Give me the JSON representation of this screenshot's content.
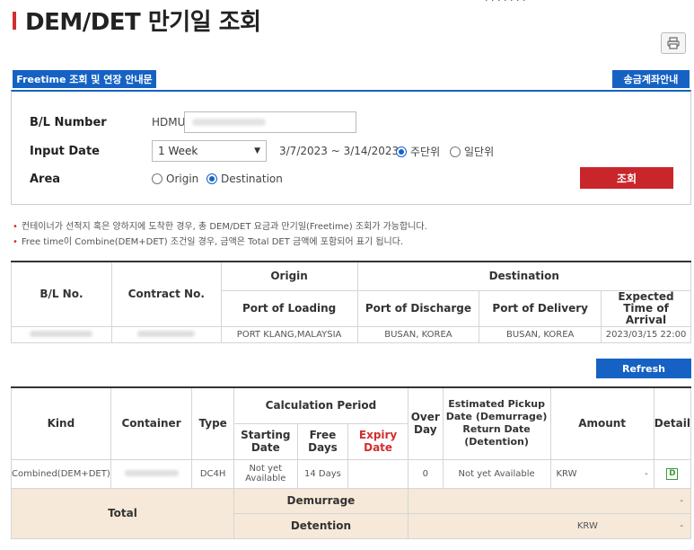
{
  "header": {
    "title": "DEM/DET 만기일 조회",
    "top_cut_text": "· · ·  · · · ·"
  },
  "buttons": {
    "freetime": "Freetime 조회 및 연장 안내문",
    "bank": "송금계좌안내",
    "search": "조회",
    "refresh": "Refresh",
    "print_icon": "printer-icon"
  },
  "search": {
    "bl_label": "B/L Number",
    "bl_prefix": "HDMU",
    "date_label": "Input Date",
    "date_select": "1 Week",
    "date_range": "3/7/2023 ~ 3/14/2023",
    "weekly": "주단위",
    "daily": "일단위",
    "area_label": "Area",
    "origin": "Origin",
    "destination": "Destination"
  },
  "notes": [
    "컨테이너가 선적지 혹은 양하지에 도착한 경우, 총 DEM/DET 요금과 만기일(Freetime) 조회가 가능합니다.",
    "Free time이 Combine(DEM+DET) 조건일 경우, 금액은 Total DET 금액에 포함되어 표기 됩니다."
  ],
  "bl_table": {
    "h_bl": "B/L No.",
    "h_contract": "Contract No.",
    "h_origin": "Origin",
    "h_destination": "Destination",
    "h_pol": "Port of Loading",
    "h_pod": "Port of Discharge",
    "h_del": "Port of Delivery",
    "h_eta": "Expected Time of Arrival",
    "row": {
      "pol": "PORT KLANG,MALAYSIA",
      "pod": "BUSAN, KOREA",
      "del": "BUSAN, KOREA",
      "eta": "2023/03/15 22:00"
    }
  },
  "calc_table": {
    "h_kind": "Kind",
    "h_container": "Container",
    "h_type": "Type",
    "h_calc": "Calculation Period",
    "h_start": "Starting Date",
    "h_free": "Free Days",
    "h_expiry": "Expiry Date",
    "h_over": "Over Day",
    "h_pickup": "Estimated Pickup Date (Demurrage) Return Date (Detention)",
    "h_amount": "Amount",
    "h_detail": "Detail",
    "row": {
      "kind": "Combined(DEM+DET)",
      "type": "DC4H",
      "start": "Not yet Available",
      "free": "14 Days",
      "expiry": "",
      "over": "0",
      "pickup": "Not yet Available",
      "currency": "KRW",
      "amount": "-",
      "detail": "D"
    },
    "total_label": "Total",
    "demurrage_label": "Demurrage",
    "detention_label": "Detention",
    "dem_value": "-",
    "det_currency": "KRW",
    "det_value": "-"
  },
  "colors": {
    "accent_blue": "#1662c4",
    "accent_red": "#c9262b",
    "total_bg": "#f6e9d9"
  }
}
